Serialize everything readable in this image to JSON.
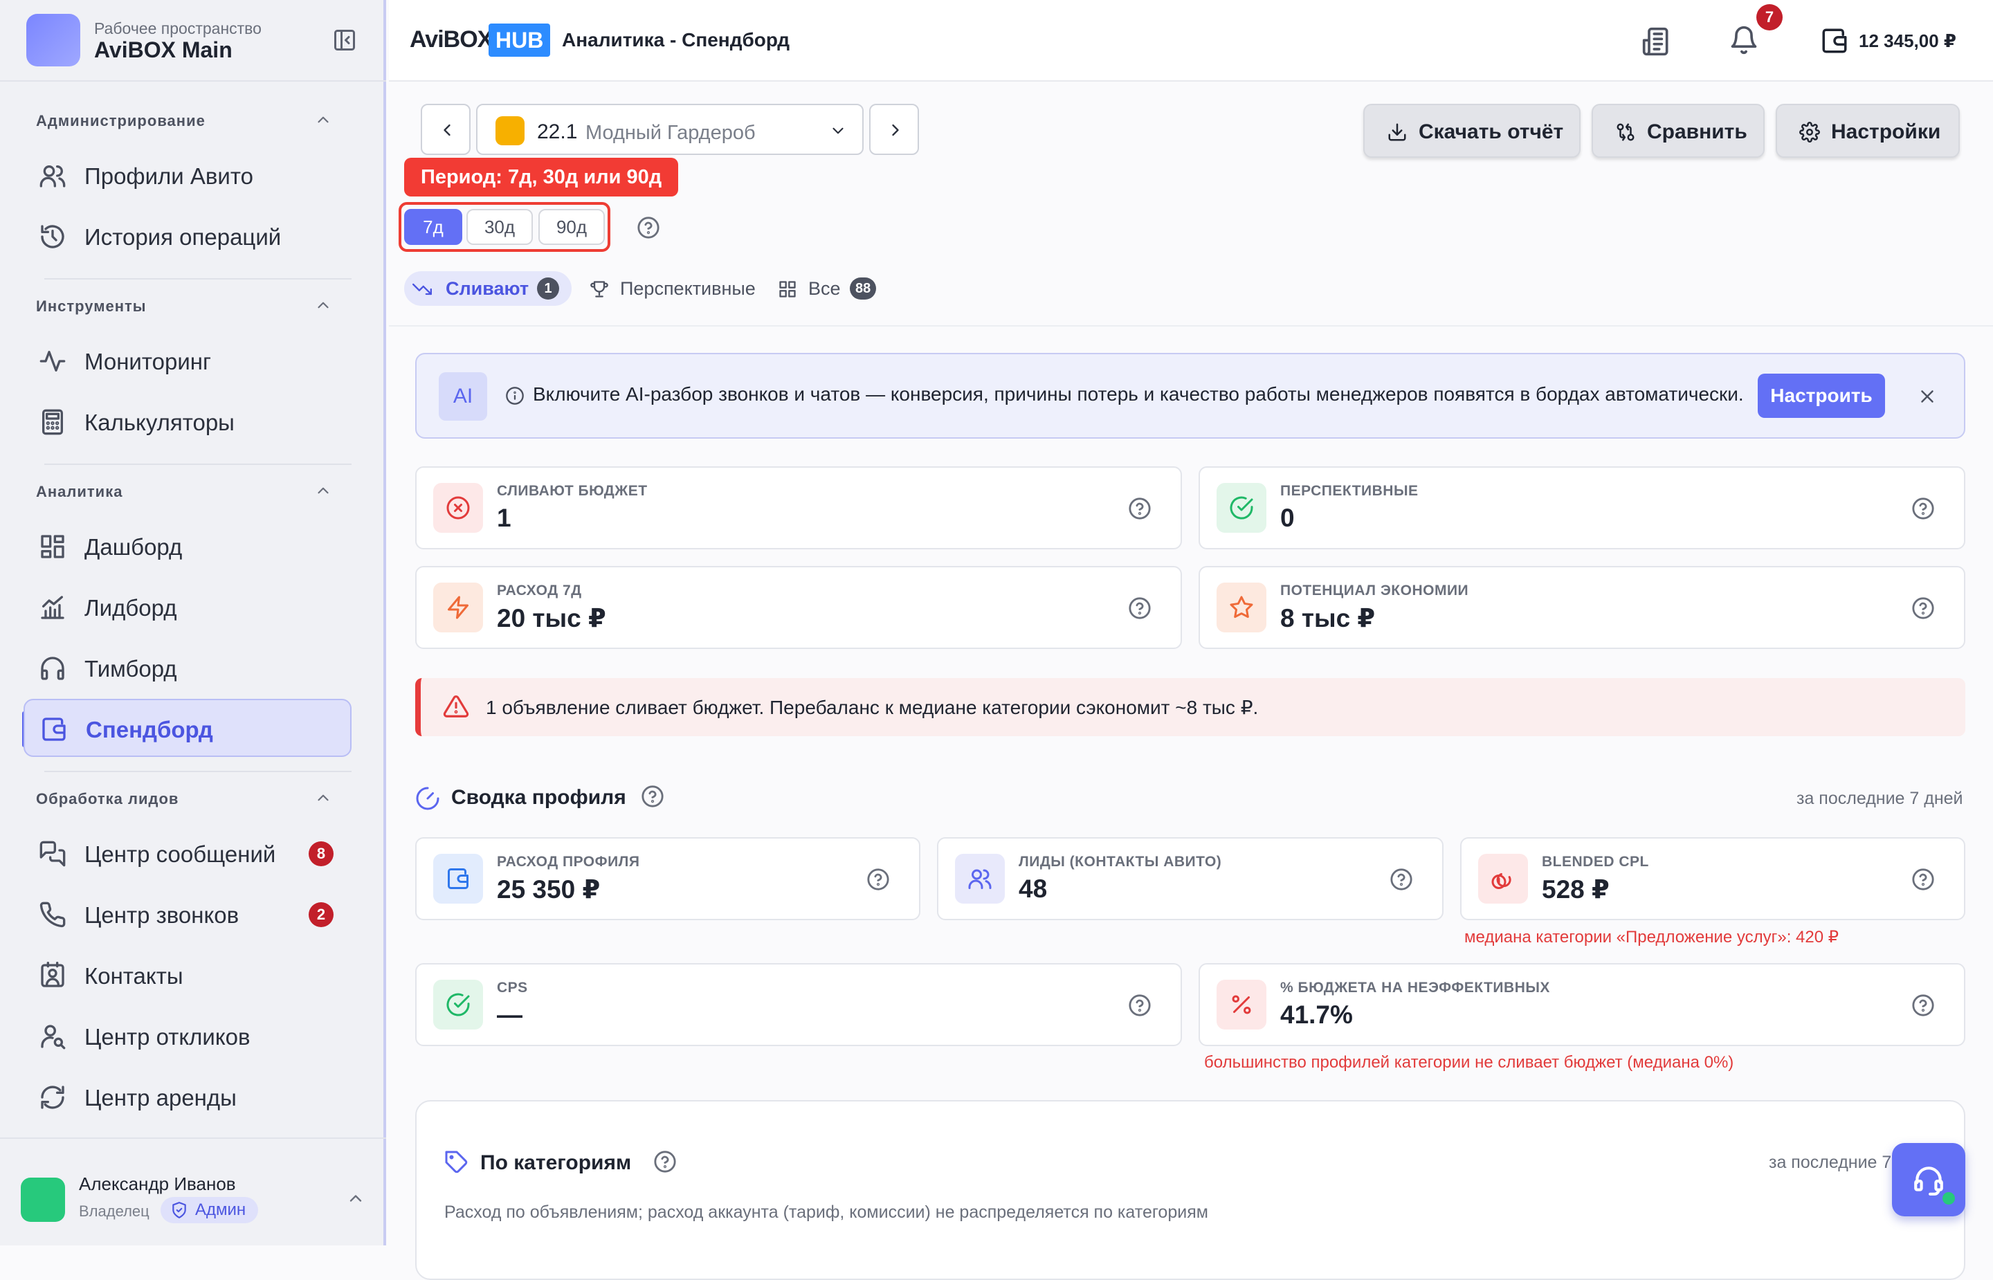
{
  "workspace": {
    "subtitle": "Рабочее пространство",
    "name": "AviBOX Main"
  },
  "sidebar": {
    "sections": [
      {
        "title": "Администрирование",
        "items": [
          {
            "label": "Профили Авито",
            "icon": "users-icon"
          },
          {
            "label": "История операций",
            "icon": "history-icon"
          }
        ]
      },
      {
        "title": "Инструменты",
        "items": [
          {
            "label": "Мониторинг",
            "icon": "activity-icon"
          },
          {
            "label": "Калькуляторы",
            "icon": "calculator-icon"
          }
        ]
      },
      {
        "title": "Аналитика",
        "items": [
          {
            "label": "Дашборд",
            "icon": "dashboard-icon"
          },
          {
            "label": "Лидборд",
            "icon": "chart-icon"
          },
          {
            "label": "Тимборд",
            "icon": "headphones-icon"
          },
          {
            "label": "Спендборд",
            "icon": "wallet-icon",
            "active": true
          }
        ]
      },
      {
        "title": "Обработка лидов",
        "items": [
          {
            "label": "Центр сообщений",
            "icon": "messages-icon",
            "badge": "8"
          },
          {
            "label": "Центр звонков",
            "icon": "phone-icon",
            "badge": "2"
          },
          {
            "label": "Контакты",
            "icon": "contacts-icon"
          },
          {
            "label": "Центр откликов",
            "icon": "user-search-icon"
          },
          {
            "label": "Центр аренды",
            "icon": "refresh-icon"
          }
        ]
      }
    ]
  },
  "user": {
    "name": "Александр Иванов",
    "role": "Владелец",
    "badge": "Админ"
  },
  "header": {
    "logo_text": "AviBOX",
    "logo_hub": "HUB",
    "title": "Аналитика - Спендборд",
    "notifications": "7",
    "balance": "12 345,00 ₽"
  },
  "toolbar": {
    "profile_num": "22.1",
    "profile_name": "Модный Гардероб",
    "download": "Скачать отчёт",
    "compare": "Сравнить",
    "settings": "Настройки"
  },
  "period": {
    "tooltip": "Период: 7д, 30д или 90д",
    "options": [
      "7д",
      "30д",
      "90д"
    ],
    "selected": "7д"
  },
  "filters": [
    {
      "label": "Сливают",
      "badge": "1",
      "active": true
    },
    {
      "label": "Перспективные"
    },
    {
      "label": "Все",
      "badge": "88"
    }
  ],
  "ai_banner": {
    "logo": "AI",
    "text": "Включите AI-разбор звонков и чатов — конверсия, причины потерь и качество работы менеджеров появятся в бордах автоматически.",
    "button": "Настроить"
  },
  "kpis": [
    {
      "label": "СЛИВАЮТ БЮДЖЕТ",
      "value": "1"
    },
    {
      "label": "ПЕРСПЕКТИВНЫЕ",
      "value": "0"
    },
    {
      "label": "РАСХОД 7Д",
      "value": "20 тыс ₽"
    },
    {
      "label": "ПОТЕНЦИАЛ ЭКОНОМИИ",
      "value": "8 тыс ₽"
    }
  ],
  "alert": "1 объявление сливает бюджет. Перебаланс к медиане категории сэкономит ~8 тыс ₽.",
  "summary": {
    "title": "Сводка профиля",
    "period": "за последние 7 дней",
    "cards": [
      {
        "label": "РАСХОД ПРОФИЛЯ",
        "value": "25 350 ₽"
      },
      {
        "label": "ЛИДЫ (КОНТАКТЫ АВИТО)",
        "value": "48"
      },
      {
        "label": "BLENDED CPL",
        "value": "528 ₽",
        "note": "медиана категории «Предложение услуг»: 420 ₽"
      },
      {
        "label": "CPS",
        "value": "—"
      },
      {
        "label": "% БЮДЖЕТА НА НЕЭФФЕКТИВНЫХ",
        "value": "41.7%",
        "note": "большинство профилей категории не сливает бюджет (медиана 0%)"
      }
    ]
  },
  "categories": {
    "title": "По категориям",
    "period": "за последние 7",
    "desc": "Расход по объявлениям; расход аккаунта (тариф, комиссии) не распределяется по категориям"
  },
  "colors": {
    "accent": "#6370f5",
    "danger": "#e23b3b",
    "success": "#1fb867"
  }
}
